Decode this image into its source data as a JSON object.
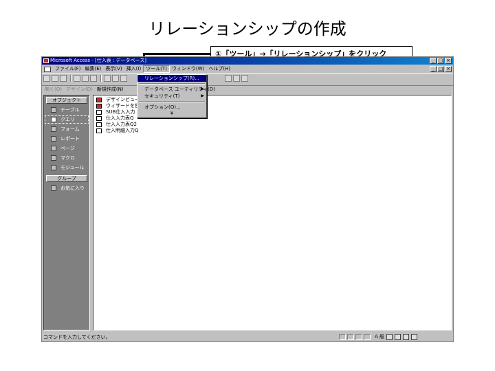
{
  "slide": {
    "title": "リレーションシップの作成",
    "callout": "①「ツール」→「リレーションシップ」をクリック"
  },
  "window": {
    "title": "Microsoft Access - [仕入表 : データベース]",
    "buttons": [
      "_",
      "□",
      "×"
    ]
  },
  "menubar": {
    "items": [
      "ファイル(F)",
      "編集(E)",
      "表示(V)",
      "挿入(I)",
      "ツール(T)",
      "ウィンドウ(W)",
      "ヘルプ(H)"
    ]
  },
  "dbbar": {
    "open": "開く(O)",
    "design": "デザイン(D)",
    "new": "新規作成(N)"
  },
  "sidebar": {
    "header": "オブジェクト",
    "items": [
      "テーブル",
      "クエリ",
      "フォーム",
      "レポート",
      "ページ",
      "マクロ",
      "モジュール"
    ],
    "groups_header": "グループ",
    "groups": [
      "お気に入り"
    ]
  },
  "objects": {
    "items": [
      "デザインビュー",
      "ウィザードを使",
      "SUB仕入入力",
      "仕入入力表Q",
      "仕入入力表Q2",
      "仕入明細入力Q"
    ]
  },
  "dropdown": {
    "items": [
      "リレーションシップ(R)...",
      "データベース ユーティリティ(D)",
      "セキュリティ(T)",
      "オプション(O)..."
    ],
    "more": "¥"
  },
  "statusbar": {
    "text": "コマンドを入力してください。",
    "ime": "A 般"
  },
  "colors": {
    "titlebar": "#000080",
    "window_bg": "#c0c0c0",
    "sidebar_bg": "#808080",
    "menu_highlight": "#000080"
  }
}
